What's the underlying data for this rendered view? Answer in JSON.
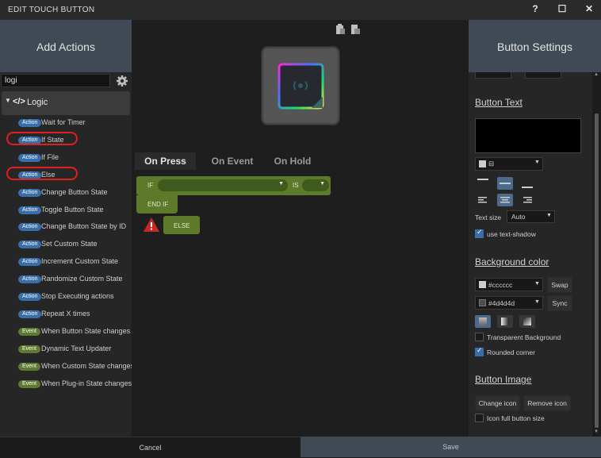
{
  "window": {
    "title": "EDIT TOUCH BUTTON",
    "help": "?",
    "maximize": "☐",
    "close": "✕"
  },
  "left": {
    "header": "Add Actions",
    "search_value": "logi",
    "category": "Logic",
    "category_glyph": "</>",
    "items": [
      {
        "badge": "Action",
        "label": "Wait for Timer"
      },
      {
        "badge": "Action",
        "label": "If State"
      },
      {
        "badge": "Action",
        "label": "If File"
      },
      {
        "badge": "Action",
        "label": "Else"
      },
      {
        "badge": "Action",
        "label": "Change Button State"
      },
      {
        "badge": "Action",
        "label": "Toggle Button State"
      },
      {
        "badge": "Action",
        "label": "Change Button State by ID"
      },
      {
        "badge": "Action",
        "label": "Set Custom State"
      },
      {
        "badge": "Action",
        "label": "Increment Custom State"
      },
      {
        "badge": "Action",
        "label": "Randomize Custom State"
      },
      {
        "badge": "Action",
        "label": "Stop Executing actions"
      },
      {
        "badge": "Action",
        "label": "Repeat X times"
      },
      {
        "badge": "Event",
        "label": "When Button State changes"
      },
      {
        "badge": "Event",
        "label": "Dynamic Text Updater"
      },
      {
        "badge": "Event",
        "label": "When Custom State changes"
      },
      {
        "badge": "Event",
        "label": "When Plug-in State changes"
      }
    ]
  },
  "center": {
    "tabs": [
      "On Press",
      "On Event",
      "On Hold"
    ],
    "if_block": {
      "if": "IF",
      "is": "IS",
      "end_if": "END IF",
      "else": "ELSE"
    }
  },
  "right": {
    "header": "Button Settings",
    "button_text_title": "Button Text",
    "text_size_label": "Text size",
    "text_size_value": "Auto",
    "text_shadow_label": "use text-shadow",
    "bg_color_title": "Background color",
    "color1": "#cccccc",
    "color2": "#4d4d4d",
    "swap": "Swap",
    "sync": "Sync",
    "transparent_bg": "Transparent Background",
    "rounded_corner": "Rounded corner",
    "button_image_title": "Button Image",
    "change_icon": "Change icon",
    "remove_icon": "Remove icon",
    "icon_full_size": "Icon full button size"
  },
  "footer": {
    "cancel": "Cancel",
    "save": "Save"
  }
}
